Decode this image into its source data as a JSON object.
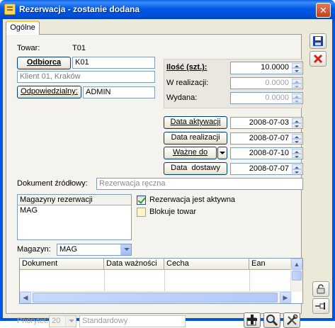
{
  "window": {
    "title": "Rezerwacja - zostanie dodana"
  },
  "tabs": [
    {
      "label": "Ogólne"
    }
  ],
  "towar": {
    "label": "Towar:",
    "value": "T01"
  },
  "odbiorca": {
    "button": "Odbiorca",
    "code": "K01",
    "description": "Klient 01, Kraków"
  },
  "odpowiedzialny": {
    "button": "Odpowiedzialny:",
    "value": "ADMIN"
  },
  "quantity": {
    "ilosc_label": "Ilość (szt.):",
    "ilosc_value": "10.0000",
    "w_realizacji_label": "W realizacji:",
    "w_realizacji_value": "0.0000",
    "wydana_label": "Wydana:",
    "wydana_value": "0.0000"
  },
  "dates": {
    "aktywacji_label": "Data aktywacji",
    "aktywacji_value": "2008-07-03",
    "realizacji_label": "Data realizacji",
    "realizacji_value": "2008-07-07",
    "wazne_label": "Ważne do",
    "wazne_value": "2008-07-10",
    "dostawy_label": "Data  dostawy",
    "dostawy_value": "2008-07-07"
  },
  "dokument": {
    "label": "Dokument źródłowy:",
    "value": "Rezerwacja ręczna"
  },
  "magazyny": {
    "header": "Magazyny rezerwacji",
    "items": [
      "MAG"
    ]
  },
  "checks": {
    "aktywna_label": "Rezerwacja jest aktywna",
    "aktywna_checked": true,
    "blokuje_label": "Blokuje towar",
    "blokuje_checked": false
  },
  "magazyn": {
    "label": "Magazyn:",
    "value": "MAG"
  },
  "grid": {
    "columns": [
      "Dokument",
      "Data ważności",
      "Cecha",
      "Ean"
    ]
  },
  "priorytet": {
    "label": "Priorytet:",
    "value": "20",
    "name": "Standardowy"
  },
  "colors": {
    "save": "#1f3f9e",
    "delete": "#d6201a",
    "title_bar": "#0058e6"
  }
}
